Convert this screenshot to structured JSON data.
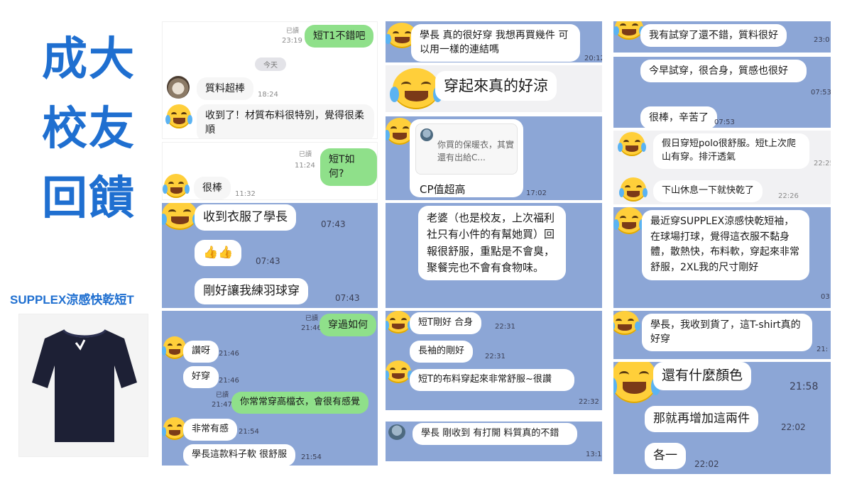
{
  "title": {
    "line1": "成大",
    "line2": "校友",
    "line3": "回饋"
  },
  "product": {
    "name": "SUPPLEX涼感快乾短T"
  },
  "colors": {
    "title_blue": "#1f6fd0",
    "chat_blue": "#8ca6d6",
    "sent_green": "#8fe08a",
    "emoji_yellow": "#ffcf3a"
  },
  "p1": {
    "read": "已讀",
    "time1": "23:19",
    "msg1": "短T1不錯吧",
    "today": "今天",
    "msg2": "質料超棒",
    "time2": "18:24",
    "msg3": "收到了！材質布料很特別，覺得很柔順"
  },
  "p2": {
    "read": "已讀",
    "time1": "11:24",
    "msg1": "短T如何?",
    "msg2": "很棒",
    "time2": "11:32"
  },
  "p3": {
    "msg1": "收到衣服了學長",
    "time1": "07:43",
    "msg2": "👍👍",
    "time2": "07:43",
    "msg3": "剛好讓我練羽球穿",
    "time3": "07:43"
  },
  "p4": {
    "read": "已讀",
    "time1": "21:46",
    "msg1": "穿過如何",
    "msg2": "讚呀",
    "time2": "21:46",
    "msg3": "好穿",
    "time3": "21:46",
    "read2": "已讀",
    "time4": "21:47",
    "msg4": "你常常穿高檔衣，會很有感覺",
    "msg5": "非常有感",
    "time5": "21:54",
    "msg6": "學長這款料子軟 很舒服",
    "time6": "21:54"
  },
  "p5": {
    "msg": "學長 真的很好穿 我想再買幾件 可以用一樣的連結嗎",
    "time": "20:12"
  },
  "p6": {
    "msg": "穿起來真的好涼"
  },
  "p7": {
    "quote": "你買的保暖衣，其實還有出給C...",
    "msg": "CP值超高",
    "time": "17:02"
  },
  "p8": {
    "msg": "老婆（也是校友，上次福利社只有小件的有幫她買）回報很舒服，重點是不會臭，聚餐完也不會有食物味。"
  },
  "p9": {
    "msg1": "短T剛好 合身",
    "time1": "22:31",
    "msg2": "長袖的剛好",
    "time2": "22:31",
    "msg3": "短T的布料穿起來非常舒服~很讚",
    "time3": "22:32"
  },
  "p10": {
    "msg": "學長 剛收到 有打開 料質真的不錯",
    "time": "13:1"
  },
  "p11": {
    "msg": "我有試穿了還不錯，質料很好",
    "time": "23:0"
  },
  "p12": {
    "msg1": "今早試穿，很合身，質感也很好",
    "time1": "07:53",
    "msg2": "很棒，辛苦了",
    "time2": "07:53"
  },
  "p13": {
    "msg1": "假日穿短polo很舒服。短t上次爬山有穿。排汗透氣",
    "time1": "22:25",
    "msg2": "下山休息一下就快乾了",
    "time2": "22:26"
  },
  "p14": {
    "msg": "最近穿SUPPLEX涼感快乾短袖，在球場打球，覺得這衣服不黏身體，散熱快，布料軟，穿起來非常舒服，2XL我的尺寸剛好",
    "time": "03"
  },
  "p15": {
    "msg": "學長，我收到貨了，這T-shirt真的好穿",
    "time": "21:"
  },
  "p16": {
    "msg1": "還有什麼顏色",
    "time1": "21:58",
    "msg2": "那就再增加這兩件",
    "time2": "22:02",
    "msg3": "各一",
    "time3": "22:02"
  }
}
